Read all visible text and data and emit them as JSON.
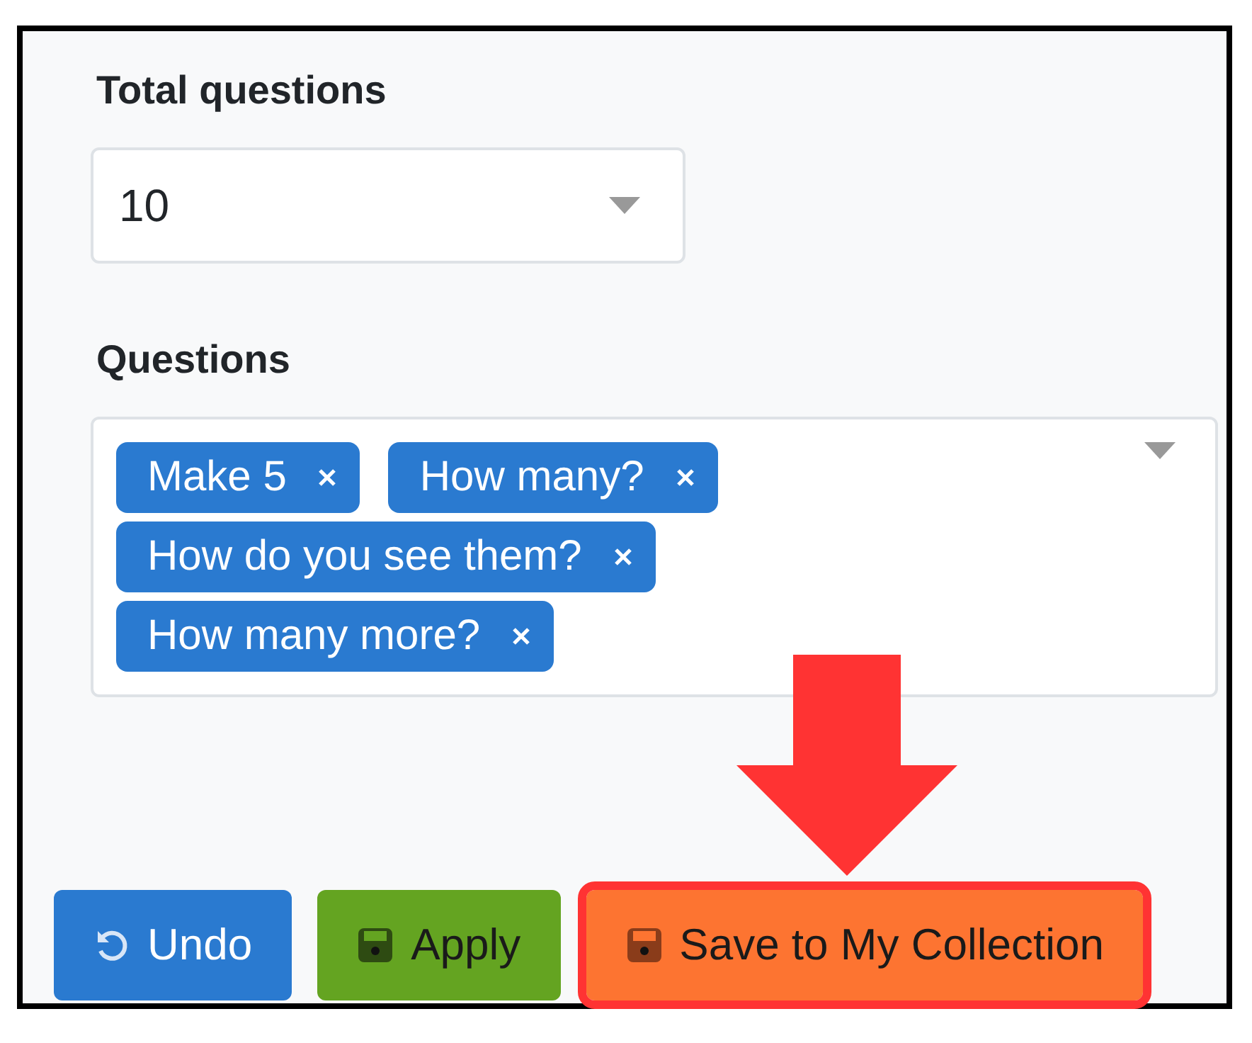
{
  "total_questions": {
    "label": "Total questions",
    "value": "10"
  },
  "questions": {
    "label": "Questions",
    "tags": [
      {
        "label": "Make 5"
      },
      {
        "label": "How many?"
      },
      {
        "label": "How do you see them?"
      },
      {
        "label": "How many more?"
      }
    ]
  },
  "buttons": [
    {
      "label": "Undo",
      "kind": "undo",
      "color": "#2a7ad0",
      "highlighted": false
    },
    {
      "label": "Apply",
      "kind": "apply",
      "color": "#64a421",
      "highlighted": false
    },
    {
      "label": "Save to My Collection",
      "kind": "save",
      "color": "#fd7431",
      "highlighted": true
    }
  ]
}
